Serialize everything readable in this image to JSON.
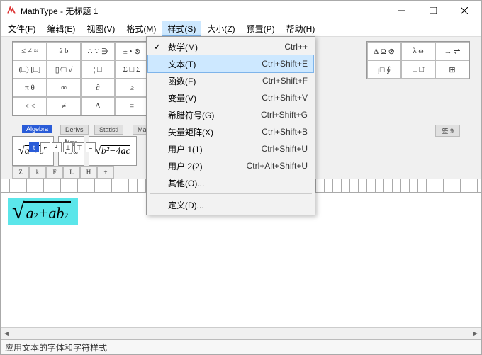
{
  "window": {
    "title": "MathType - 无标题 1"
  },
  "menubar": {
    "items": [
      {
        "label": "文件(F)"
      },
      {
        "label": "编辑(E)"
      },
      {
        "label": "视图(V)"
      },
      {
        "label": "格式(M)"
      },
      {
        "label": "样式(S)",
        "open": true
      },
      {
        "label": "大小(Z)"
      },
      {
        "label": "预置(P)"
      },
      {
        "label": "帮助(H)"
      }
    ]
  },
  "style_menu": {
    "items": [
      {
        "label": "数学(M)",
        "shortcut": "Ctrl++",
        "checked": true
      },
      {
        "label": "文本(T)",
        "shortcut": "Ctrl+Shift+E",
        "highlight": true
      },
      {
        "label": "函数(F)",
        "shortcut": "Ctrl+Shift+F"
      },
      {
        "label": "变量(V)",
        "shortcut": "Ctrl+Shift+V"
      },
      {
        "label": "希腊符号(G)",
        "shortcut": "Ctrl+Shift+G"
      },
      {
        "label": "矢量矩阵(X)",
        "shortcut": "Ctrl+Shift+B"
      },
      {
        "label": "用户 1(1)",
        "shortcut": "Ctrl+Shift+U"
      },
      {
        "label": "用户 2(2)",
        "shortcut": "Ctrl+Alt+Shift+U"
      },
      {
        "label": "其他(O)...",
        "shortcut": ""
      }
    ],
    "define": {
      "label": "定义(D)...",
      "shortcut": ""
    }
  },
  "palette_left": [
    "≤ ≠ ≈",
    "ȧ b̄",
    "∴ ∵ ∋",
    "± • ⊗",
    "(□) [□]",
    "▯/□ √",
    "¦ □",
    "Σ □ Σ",
    "π  θ",
    "∞",
    "∂",
    "≥",
    "<  ≤"
  ],
  "palette_right": [
    "∆ Ω ⊗",
    "λ ω",
    "∫□ ∮",
    "□̇ □̈"
  ],
  "tabs": {
    "algebra": "Algebra",
    "derivs": "Derivs",
    "statisti": "Statisti",
    "matri": "Matri",
    "tag9": "签 9"
  },
  "equation_row": {
    "eq1": "√(a²+b²)",
    "eq2": "lim  x→∞",
    "eq3": "√(b²−4ac)"
  },
  "small_row": [
    "Z",
    "k",
    "F",
    "L",
    "H",
    "±",
    "?",
    "?"
  ],
  "canvas_formula": {
    "a": "a",
    "b": "ab",
    "sq": "2",
    "plus": " + "
  },
  "statusbar": {
    "text": "应用文本的字体和字符样式"
  }
}
